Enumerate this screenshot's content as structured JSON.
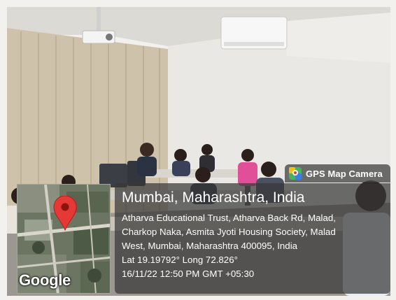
{
  "badge": {
    "label": "GPS Map Camera",
    "icon": "gps-map-camera-app-icon"
  },
  "location": {
    "title": "Mumbai, Maharashtra, India",
    "address_lines": [
      "Atharva Educational Trust, Atharva Back Rd, Malad,",
      "Charkop Naka, Asmita Jyoti Housing Society, Malad",
      "West, Mumbai, Maharashtra 400095, India"
    ],
    "coordinates": "Lat 19.19792° Long 72.826°",
    "timestamp": "16/11/22 12:50 PM GMT +05:30"
  },
  "map": {
    "attribution": "Google",
    "pin_icon": "map-pin-icon",
    "pin_color": "#e53935"
  },
  "colors": {
    "overlay": "#373737",
    "wall": "#e9e8e4",
    "curtain": "#cdbfa8"
  }
}
